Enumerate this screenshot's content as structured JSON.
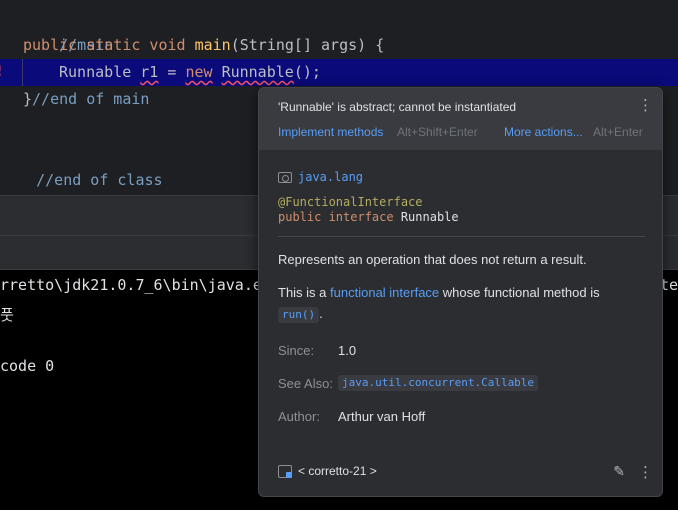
{
  "editor": {
    "line1_comment": "//main",
    "line2_kw": "public static void",
    "line2_fn": "main",
    "line2_rest": "(String[] args) {",
    "line3_type": "Runnable",
    "line3_var": "r1",
    "line3_eq": " = ",
    "line3_new": "new",
    "line3_class": "Runnable",
    "line3_end": "();",
    "line4_brace": "}",
    "line4_comment": "//end of main",
    "line6_comment": "//end of class",
    "error_gutter_icon": "error-icon"
  },
  "console": {
    "line1": "rretto\\jdk21.0.7_6\\bin\\java.e",
    "line1_tail": "te",
    "line2": "풋",
    "line3": "code 0"
  },
  "popup": {
    "error_message": "'Runnable' is abstract; cannot be instantiated",
    "actions": [
      {
        "label": "Implement methods",
        "shortcut": "Alt+Shift+Enter"
      },
      {
        "label": "More actions...",
        "shortcut": "Alt+Enter"
      }
    ],
    "package": "java.lang",
    "annotation": "@FunctionalInterface",
    "signature_kw": "public interface",
    "signature_class": "Runnable",
    "description": "Represents an operation that does not return a result.",
    "functional_prefix": "This is a",
    "functional_link": "functional interface",
    "functional_suffix": "whose functional method is",
    "functional_method": "run()",
    "functional_end": ".",
    "since_label": "Since:",
    "since_value": "1.0",
    "see_also_label": "See Also:",
    "see_also_value": "java.util.concurrent.Callable",
    "author_label": "Author:",
    "author_value": "Arthur van Hoff",
    "library": "< corretto-21 >",
    "colors": {
      "link": "#589df6",
      "error": "#f75464",
      "highlight_line": "#0a0a7a"
    }
  }
}
